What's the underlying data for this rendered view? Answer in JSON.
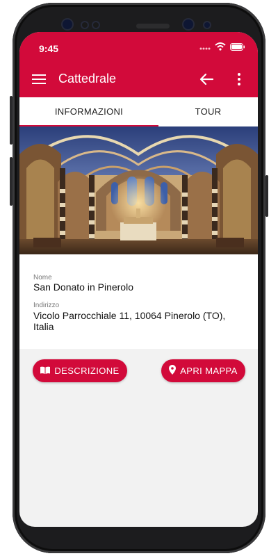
{
  "status_bar": {
    "time": "9:45"
  },
  "app_bar": {
    "title": "Cattedrale",
    "icons": [
      "menu-icon",
      "back-arrow-icon",
      "more-vertical-icon"
    ]
  },
  "tabs": [
    {
      "label": "INFORMAZIONI",
      "selected": true
    },
    {
      "label": "TOUR",
      "selected": false
    }
  ],
  "details": {
    "name_label": "Nome",
    "name_value": "San Donato in Pinerolo",
    "address_label": "Indirizzo",
    "address_value": "Vicolo Parrocchiale 11, 10064 Pinerolo (TO), Italia"
  },
  "actions": {
    "description_label": "DESCRIZIONE",
    "description_icon": "book-icon",
    "map_label": "APRI MAPPA",
    "map_icon": "map-pin-icon"
  },
  "colors": {
    "primary": "#d20a3a",
    "background": "#f2f2f2",
    "card": "#ffffff"
  }
}
